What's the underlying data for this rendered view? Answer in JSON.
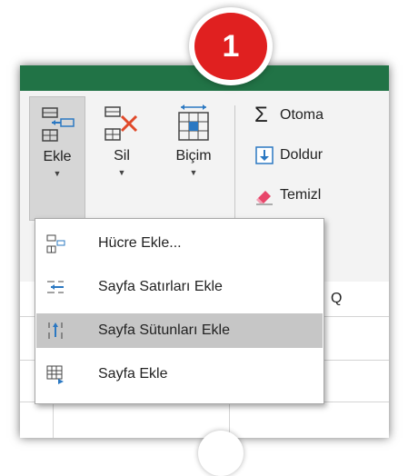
{
  "ribbon": {
    "insert": {
      "label": "Ekle"
    },
    "delete": {
      "label": "Sil"
    },
    "format": {
      "label": "Biçim"
    },
    "autosum": {
      "label": "Otoma"
    },
    "fill": {
      "label": "Doldur"
    },
    "clear": {
      "label": "Temizl"
    }
  },
  "menu": {
    "items": [
      {
        "label": "Hücre Ekle...",
        "icon": "insert-cells-icon"
      },
      {
        "label": "Sayfa Satırları Ekle",
        "icon": "insert-rows-icon"
      },
      {
        "label": "Sayfa Sütunları Ekle",
        "icon": "insert-columns-icon",
        "highlighted": true
      },
      {
        "label": "Sayfa Ekle",
        "icon": "insert-sheet-icon"
      }
    ]
  },
  "sheet": {
    "column_header": "Q"
  },
  "callout": {
    "number": "1",
    "color": "#e02020"
  },
  "colors": {
    "excel_green": "#217346",
    "highlight": "#c6c6c6"
  }
}
